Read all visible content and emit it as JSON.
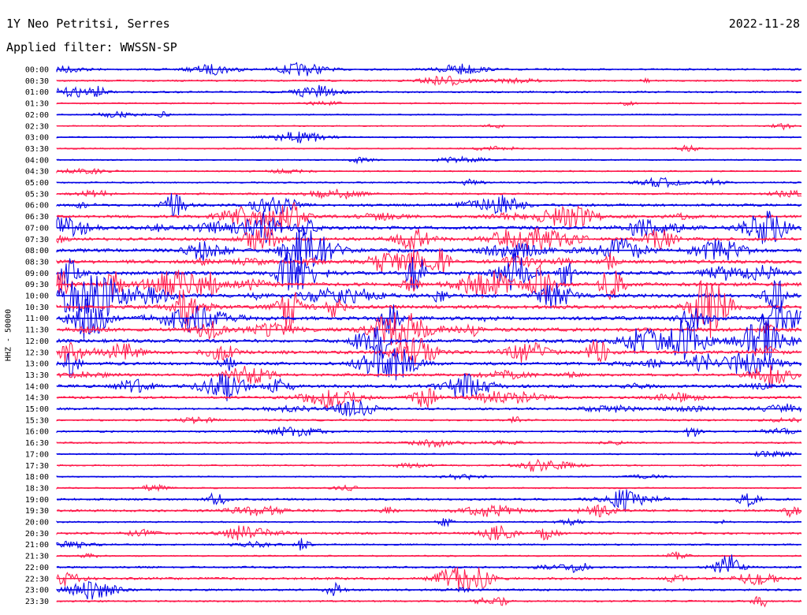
{
  "header": {
    "station": "1Y Neo Petritsi, Serres",
    "date": "2022-11-28",
    "filter": "Applied filter: WWSSN-SP"
  },
  "channel_label": "HHZ - 50000",
  "colors": {
    "trace_a": "#0000e6",
    "trace_b": "#ff1a4b"
  },
  "chart_data": {
    "type": "helicorder",
    "title": "1Y Neo Petritsi, Serres",
    "date": "2022-11-28",
    "filter": "WWSSN-SP",
    "ylabel": "HHZ - 50000",
    "line_minutes": 30,
    "row_labels": [
      "00:00",
      "00:30",
      "01:00",
      "01:30",
      "02:00",
      "02:30",
      "03:00",
      "03:30",
      "04:00",
      "04:30",
      "05:00",
      "05:30",
      "06:00",
      "06:30",
      "07:00",
      "07:30",
      "08:00",
      "08:30",
      "09:00",
      "09:30",
      "10:00",
      "10:30",
      "11:00",
      "11:30",
      "12:00",
      "12:30",
      "13:00",
      "13:30",
      "14:00",
      "14:30",
      "15:00",
      "15:30",
      "16:00",
      "16:30",
      "17:00",
      "17:30",
      "18:00",
      "18:30",
      "19:00",
      "19:30",
      "20:00",
      "20:30",
      "21:00",
      "21:30",
      "22:00",
      "22:30",
      "23:00",
      "23:30"
    ],
    "row_activity": [
      0.35,
      0.25,
      0.3,
      0.15,
      0.1,
      0.1,
      0.15,
      0.1,
      0.1,
      0.15,
      0.2,
      0.3,
      0.6,
      0.7,
      0.9,
      0.8,
      1.0,
      1.0,
      1.0,
      1.0,
      1.0,
      1.0,
      1.0,
      1.0,
      1.0,
      0.9,
      0.8,
      0.6,
      0.8,
      0.6,
      0.5,
      0.3,
      0.3,
      0.25,
      0.15,
      0.2,
      0.1,
      0.15,
      0.4,
      0.5,
      0.2,
      0.45,
      0.25,
      0.15,
      0.35,
      0.55,
      0.4,
      0.3
    ],
    "series_colors": [
      "blue",
      "red"
    ]
  }
}
